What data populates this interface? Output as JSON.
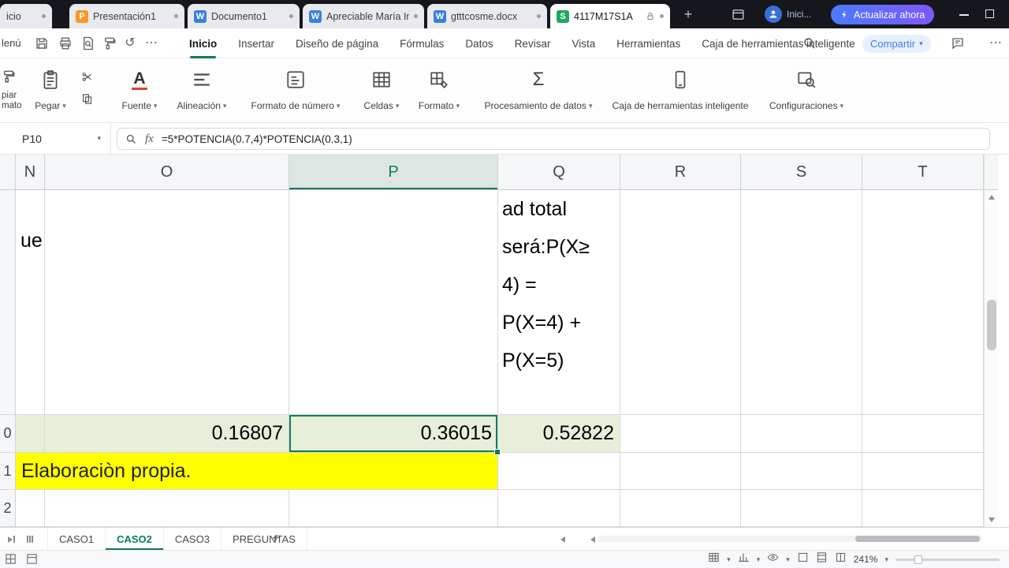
{
  "colors": {
    "accent": "#0f7b5e",
    "selection_fill": "#e7efdb",
    "highlight_yellow": "#ffff00",
    "share_blue": "#3d7df5",
    "icon_orange": "#f59a23",
    "icon_word_blue": "#3b7fe0",
    "icon_sheet_green": "#21a663"
  },
  "glyphs": {
    "caret_down": "▾",
    "undo": "↺",
    "more": "⋯",
    "sigma": "Σ",
    "letter_a": "A",
    "plus": "+",
    "ppt": "P",
    "word": "W",
    "sheet": "S"
  },
  "titlebar": {
    "tabs": [
      {
        "label": "icio"
      },
      {
        "label": "Presentación1"
      },
      {
        "label": "Documento1"
      },
      {
        "label": "Apreciable María Iné"
      },
      {
        "label": "gtttcosme.docx"
      },
      {
        "label": "4117M17S1A"
      }
    ],
    "user_label": "Inici...",
    "update_button_label": "Actualizar ahora"
  },
  "quickbar": {
    "menu_label": "lenú",
    "ribbon_tabs": [
      {
        "label": "Inicio"
      },
      {
        "label": "Insertar"
      },
      {
        "label": "Diseño de página"
      },
      {
        "label": "Fórmulas"
      },
      {
        "label": "Datos"
      },
      {
        "label": "Revisar"
      },
      {
        "label": "Vista"
      },
      {
        "label": "Herramientas"
      },
      {
        "label": "Caja de herramientas inteligente"
      }
    ],
    "share_label": "Compartir"
  },
  "ribbon": {
    "format_painter_lines": [
      "piar",
      "mato"
    ],
    "paste_label": "Pegar",
    "font_label": "Fuente",
    "alignment_label": "Alineación",
    "number_format_label": "Formato de número",
    "cells_label": "Celdas",
    "format_label": "Formato",
    "data_processing_label": "Procesamiento de datos",
    "smart_toolbox_label": "Caja de herramientas inteligente",
    "settings_label": "Configuraciones"
  },
  "formula_bar": {
    "name_box": "P10",
    "fx_label": "fx",
    "formula": "=5*POTENCIA(0.7,4)*POTENCIA(0.3,1)"
  },
  "grid": {
    "columns": [
      "N",
      "O",
      "P",
      "Q",
      "R",
      "S",
      "T"
    ],
    "selected_column": "P",
    "selected_cell": "P10",
    "row_numbers": [
      "0",
      "1",
      "2"
    ],
    "n9_overflow": "ue",
    "q9_lines": [
      "ad total",
      "será:P(X≥",
      "4) =",
      "P(X=4) +",
      "P(X=5)"
    ],
    "o10": "0.16807",
    "p10": "0.36015",
    "q10": "0.52822",
    "note": "Elaboraciòn propia."
  },
  "sheet_bar": {
    "tabs": [
      {
        "label": "CASO1"
      },
      {
        "label": "CASO2"
      },
      {
        "label": "CASO3"
      },
      {
        "label": "PREGUNTAS"
      }
    ],
    "active_tab": "CASO2"
  },
  "status_bar": {
    "zoom": "241%"
  }
}
